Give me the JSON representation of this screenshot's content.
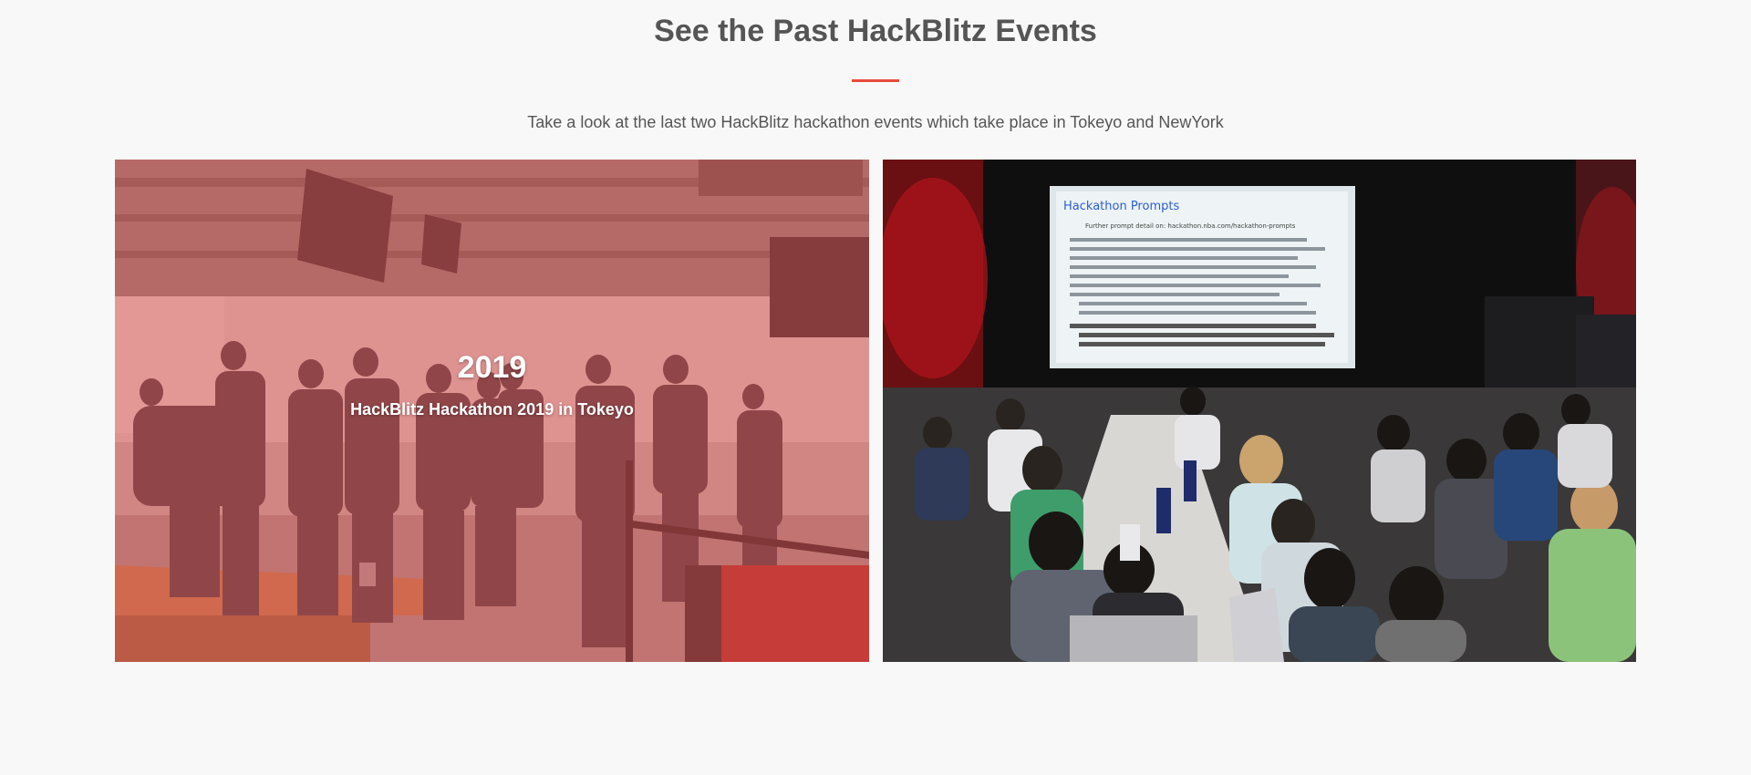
{
  "section": {
    "title": "See the Past HackBlitz Events",
    "subtitle": "Take a look at the last two HackBlitz hackathon events which take place in Tokeyo and NewYork",
    "accent_color": "#e74c3c"
  },
  "events": [
    {
      "year": "2019",
      "caption": "HackBlitz Hackathon 2019 in Tokeyo",
      "image": "hackathon-venue-photo",
      "overlay_active": true
    },
    {
      "image": "hackathon-hall-photo",
      "projected_slide": {
        "heading": "Hackathon Prompts",
        "line": "Further prompt detail on: hackathon.nba.com/hackathon-prompts"
      }
    }
  ]
}
